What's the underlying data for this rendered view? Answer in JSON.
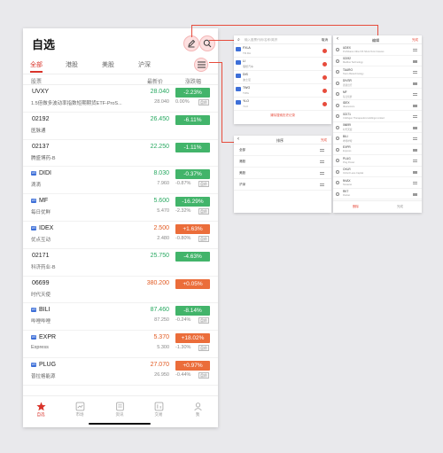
{
  "main": {
    "title": "自选",
    "tabs": [
      "全部",
      "港股",
      "美股",
      "沪深"
    ],
    "active_tab": 0,
    "columns": {
      "name": "股票",
      "price": "最新价",
      "change": "涨跌幅"
    },
    "rows": [
      {
        "code": "UVXY",
        "name": "1.5倍做多波动率指数短期期货ETF-ProS...",
        "tag": "",
        "price": "28.040",
        "sub_price": "28.040",
        "sub_pct": "0.00%",
        "mini": "盘前",
        "change": "-2.23%",
        "dir": "down"
      },
      {
        "code": "02192",
        "name": "医脉通",
        "tag": "",
        "price": "26.450",
        "sub_price": "",
        "sub_pct": "",
        "mini": "",
        "change": "-6.11%",
        "dir": "down"
      },
      {
        "code": "02137",
        "name": "腾盛博药-B",
        "tag": "",
        "price": "22.250",
        "sub_price": "",
        "sub_pct": "",
        "mini": "",
        "change": "-1.11%",
        "dir": "down"
      },
      {
        "code": "DIDI",
        "name": "滴滴",
        "tag": "US",
        "price": "8.030",
        "sub_price": "7.960",
        "sub_pct": "-0.87%",
        "mini": "盘前",
        "change": "-0.37%",
        "dir": "down"
      },
      {
        "code": "MF",
        "name": "每日优鲜",
        "tag": "US",
        "price": "5.600",
        "sub_price": "5.470",
        "sub_pct": "-2.32%",
        "mini": "盘前",
        "change": "-16.29%",
        "dir": "down"
      },
      {
        "code": "IDEX",
        "name": "优点互动",
        "tag": "US",
        "price": "2.500",
        "sub_price": "2.480",
        "sub_pct": "-0.80%",
        "mini": "盘前",
        "change": "+1.63%",
        "dir": "up"
      },
      {
        "code": "02171",
        "name": "科济药业-B",
        "tag": "",
        "price": "25.750",
        "sub_price": "",
        "sub_pct": "",
        "mini": "",
        "change": "-4.63%",
        "dir": "down"
      },
      {
        "code": "06699",
        "name": "时代天使",
        "tag": "",
        "price": "380.200",
        "sub_price": "",
        "sub_pct": "",
        "mini": "",
        "change": "+0.05%",
        "dir": "up"
      },
      {
        "code": "BILI",
        "name": "哔哩哔哩",
        "tag": "US",
        "price": "87.460",
        "sub_price": "87.250",
        "sub_pct": "-0.24%",
        "mini": "盘前",
        "change": "-8.14%",
        "dir": "down"
      },
      {
        "code": "EXPR",
        "name": "Express",
        "tag": "US",
        "price": "5.370",
        "sub_price": "5.300",
        "sub_pct": "-1.30%",
        "mini": "盘前",
        "change": "+18.02%",
        "dir": "up"
      },
      {
        "code": "PLUG",
        "name": "普拉格能源",
        "tag": "US",
        "price": "27.070",
        "sub_price": "26.950",
        "sub_pct": "-0.44%",
        "mini": "盘前",
        "change": "+0.97%",
        "dir": "up"
      }
    ],
    "tabbar": [
      "自选",
      "市场",
      "资讯",
      "交易",
      "我"
    ]
  },
  "search_screen": {
    "placeholder": "输入股票代码/名称/简拼",
    "cancel": "取消",
    "items": [
      {
        "code": "FXLA",
        "name": "TR.DA"
      },
      {
        "code": "LI",
        "name": "理想汽车"
      },
      {
        "code": "DIS",
        "name": "迪士尼"
      },
      {
        "code": "TWG",
        "name": "TWG"
      },
      {
        "code": "YLO",
        "name": "YLO"
      }
    ],
    "footer": "清除搜索历史记录"
  },
  "sort_screen": {
    "title": "排序",
    "done": "完成",
    "items": [
      "全部",
      "港股",
      "美股",
      "沪深"
    ]
  },
  "edit_screen": {
    "title": "编辑",
    "done": "完成",
    "items": [
      {
        "code": "UDEX",
        "name": "ProShares Ultra VIX Short-Term Futures"
      },
      {
        "code": "02192",
        "name": "Medlive Technology"
      },
      {
        "code": "TAURO",
        "name": "Tauro Biotechnology"
      },
      {
        "code": "DIVSR",
        "name": "滴滴出行"
      },
      {
        "code": "MF",
        "name": "每日优鲜"
      },
      {
        "code": "IDEX",
        "name": "Ideanomics"
      },
      {
        "code": "02171",
        "name": "CARsgen Therapeutics Holdings Limited"
      },
      {
        "code": "06699",
        "name": "时代天使"
      },
      {
        "code": "BILI",
        "name": "哔哩哔哩"
      },
      {
        "code": "EXPR",
        "name": "Express"
      },
      {
        "code": "PLUG",
        "name": "Plug Power"
      },
      {
        "code": "OXLR",
        "name": "Oxford Lane Capital"
      },
      {
        "code": "NVAX",
        "name": "Novavax"
      },
      {
        "code": "RKT",
        "name": "Rocket"
      }
    ],
    "footer_left": "删除",
    "footer_right": "完成"
  },
  "colors": {
    "accent": "#d9332a",
    "up": "#eb6d3a",
    "down": "#42b46a",
    "connector": "#e74c3c"
  }
}
